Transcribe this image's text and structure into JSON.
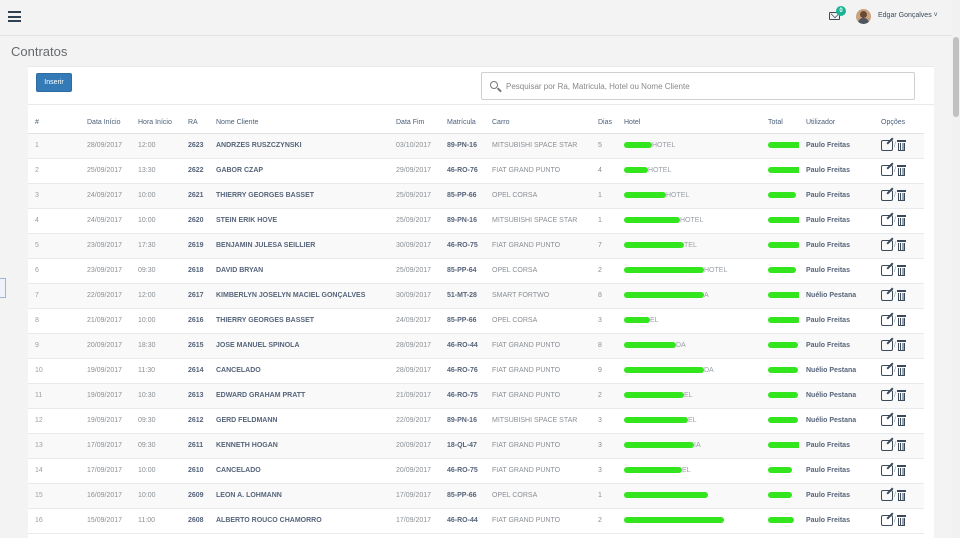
{
  "header": {
    "notification_count": "0",
    "username": "Edgar Gonçalves ˅"
  },
  "page": {
    "title": "Contratos",
    "insert_label": "Inserir",
    "search_placeholder": "Pesquisar por Ra, Matricula, Hotel ou Nome Cliente"
  },
  "table": {
    "columns": [
      "#",
      "Data Início",
      "Hora Início",
      "RA",
      "Nome Cliente",
      "Data Fim",
      "Matrícula",
      "Carro",
      "Dias",
      "Hotel",
      "Total",
      "Utilizador",
      "Opções"
    ],
    "rows": [
      {
        "n": "1",
        "data_inicio": "28/09/2017",
        "hora": "12:00",
        "ra": "2623",
        "cliente": "ANDRZES RUSZCZYNSKI",
        "data_fim": "03/10/2017",
        "matricula": "89-PN-16",
        "carro": "MITSUBISHI SPACE STAR",
        "dias": "5",
        "hotel": "HOTEL",
        "utilizador": "Paulo Freitas"
      },
      {
        "n": "2",
        "data_inicio": "25/09/2017",
        "hora": "13:30",
        "ra": "2622",
        "cliente": "GABOR CZAP",
        "data_fim": "29/09/2017",
        "matricula": "46-RO-76",
        "carro": "FIAT GRAND PUNTO",
        "dias": "4",
        "hotel": "HOTEL",
        "utilizador": "Paulo Freitas"
      },
      {
        "n": "3",
        "data_inicio": "24/09/2017",
        "hora": "10:00",
        "ra": "2621",
        "cliente": "THIERRY GEORGES BASSET",
        "data_fim": "25/09/2017",
        "matricula": "85-PP-66",
        "carro": "OPEL CORSA",
        "dias": "1",
        "hotel": "HOTEL",
        "utilizador": "Paulo Freitas"
      },
      {
        "n": "4",
        "data_inicio": "24/09/2017",
        "hora": "10:00",
        "ra": "2620",
        "cliente": "STEIN ERIK HOVE",
        "data_fim": "25/09/2017",
        "matricula": "89-PN-16",
        "carro": "MITSUBISHI SPACE STAR",
        "dias": "1",
        "hotel": "HOTEL",
        "utilizador": "Paulo Freitas"
      },
      {
        "n": "5",
        "data_inicio": "23/09/2017",
        "hora": "17:30",
        "ra": "2619",
        "cliente": "BENJAMIN JULESA SEILLIER",
        "data_fim": "30/09/2017",
        "matricula": "46-RO-75",
        "carro": "FIAT GRAND PUNTO",
        "dias": "7",
        "hotel": "TEL",
        "utilizador": "Paulo Freitas"
      },
      {
        "n": "6",
        "data_inicio": "23/09/2017",
        "hora": "09:30",
        "ra": "2618",
        "cliente": "DAVID BRYAN",
        "data_fim": "25/09/2017",
        "matricula": "85-PP-64",
        "carro": "OPEL CORSA",
        "dias": "2",
        "hotel": "HOTEL",
        "utilizador": "Paulo Freitas"
      },
      {
        "n": "7",
        "data_inicio": "22/09/2017",
        "hora": "12:00",
        "ra": "2617",
        "cliente": "KIMBERLYN JOSELYN MACIEL GONÇALVES",
        "data_fim": "30/09/2017",
        "matricula": "51-MT-28",
        "carro": "SMART FORTWO",
        "dias": "8",
        "hotel": "A",
        "utilizador": "Nuélio Pestana"
      },
      {
        "n": "8",
        "data_inicio": "21/09/2017",
        "hora": "10:00",
        "ra": "2616",
        "cliente": "THIERRY GEORGES BASSET",
        "data_fim": "24/09/2017",
        "matricula": "85-PP-66",
        "carro": "OPEL CORSA",
        "dias": "3",
        "hotel": "EL",
        "utilizador": "Paulo Freitas"
      },
      {
        "n": "9",
        "data_inicio": "20/09/2017",
        "hora": "18:30",
        "ra": "2615",
        "cliente": "JOSE MANUEL SPINOLA",
        "data_fim": "28/09/2017",
        "matricula": "46-RO-44",
        "carro": "FIAT GRAND PUNTO",
        "dias": "8",
        "hotel": "DA",
        "utilizador": "Paulo Freitas"
      },
      {
        "n": "10",
        "data_inicio": "19/09/2017",
        "hora": "11:30",
        "ra": "2614",
        "cliente": "CANCELADO",
        "data_fim": "28/09/2017",
        "matricula": "46-RO-76",
        "carro": "FIAT GRAND PUNTO",
        "dias": "9",
        "hotel": "DA",
        "utilizador": "Nuélio Pestana"
      },
      {
        "n": "11",
        "data_inicio": "19/09/2017",
        "hora": "10:30",
        "ra": "2613",
        "cliente": "EDWARD GRAHAM PRATT",
        "data_fim": "21/09/2017",
        "matricula": "46-RO-75",
        "carro": "FIAT GRAND PUNTO",
        "dias": "2",
        "hotel": "EL",
        "utilizador": "Nuélio Pestana"
      },
      {
        "n": "12",
        "data_inicio": "19/09/2017",
        "hora": "09:30",
        "ra": "2612",
        "cliente": "GERD FELDMANN",
        "data_fim": "22/09/2017",
        "matricula": "89-PN-16",
        "carro": "MITSUBISHI SPACE STAR",
        "dias": "3",
        "hotel": "EL",
        "utilizador": "Nuélio Pestana"
      },
      {
        "n": "13",
        "data_inicio": "17/09/2017",
        "hora": "09:30",
        "ra": "2611",
        "cliente": "KENNETH HOGAN",
        "data_fim": "20/09/2017",
        "matricula": "18-QL-47",
        "carro": "FIAT GRAND PUNTO",
        "dias": "3",
        "hotel": "IA",
        "utilizador": "Paulo Freitas"
      },
      {
        "n": "14",
        "data_inicio": "17/09/2017",
        "hora": "10:00",
        "ra": "2610",
        "cliente": "CANCELADO",
        "data_fim": "20/09/2017",
        "matricula": "46-RO-75",
        "carro": "FIAT GRAND PUNTO",
        "dias": "3",
        "hotel": "EL",
        "utilizador": "Paulo Freitas"
      },
      {
        "n": "15",
        "data_inicio": "16/09/2017",
        "hora": "10:00",
        "ra": "2609",
        "cliente": "LEON A. LOHMANN",
        "data_fim": "17/09/2017",
        "matricula": "85-PP-66",
        "carro": "OPEL CORSA",
        "dias": "1",
        "hotel": "",
        "utilizador": "Paulo Freitas"
      },
      {
        "n": "16",
        "data_inicio": "15/09/2017",
        "hora": "11:00",
        "ra": "2608",
        "cliente": "ALBERTO ROUCO CHAMORRO",
        "data_fim": "17/09/2017",
        "matricula": "46-RO-44",
        "carro": "FIAT GRAND PUNTO",
        "dias": "2",
        "hotel": "",
        "utilizador": "Paulo Freitas"
      }
    ]
  },
  "colors": {
    "redaction": "#33e51c",
    "primary_button": "#337ab7",
    "badge": "#1ab394"
  }
}
